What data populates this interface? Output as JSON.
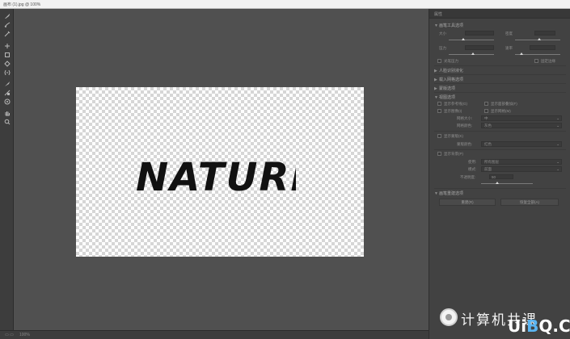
{
  "window": {
    "title": "画布 (1).jpg @ 100%"
  },
  "tools": [
    {
      "name": "brush-icon"
    },
    {
      "name": "reconstruct-icon"
    },
    {
      "name": "smooth-icon"
    },
    {
      "name": "pucker-icon"
    },
    {
      "name": "bloat-icon"
    },
    {
      "name": "push-icon"
    },
    {
      "name": "twirl-icon"
    },
    {
      "name": "mirror-icon"
    },
    {
      "name": "freeze-mask-icon"
    },
    {
      "name": "thaw-mask-icon"
    },
    {
      "name": "face-icon"
    },
    {
      "name": "hand-icon"
    },
    {
      "name": "zoom-icon"
    }
  ],
  "canvas": {
    "text": "NATURE"
  },
  "status": {
    "zoom": "100%"
  },
  "panel": {
    "title": "属性",
    "brush_section": "画笔工具选项",
    "size_label": "大小",
    "size_value": "",
    "density_label": "密度",
    "pressure_label": "压力",
    "pressure_value": "",
    "rate_label": "速率",
    "stylus_label": "光笔压力",
    "pin_label": "固定边缘",
    "face_section": "人脸识别液化",
    "load_mesh_section": "载入网格选项",
    "mask_section": "蒙版选项",
    "view_section": "视图选项",
    "show_guides": "显示参考线(G)",
    "show_face": "显示面部叠加(F)",
    "show_image": "显示图像(I)",
    "show_mesh": "显示网格(M)",
    "mesh_size_label": "网格大小:",
    "mesh_size_value": "中",
    "mesh_color_label": "网格颜色:",
    "mesh_color_value": "灰色",
    "show_mask": "显示蒙版(K)",
    "mask_color_label": "蒙版颜色:",
    "mask_color_value": "红色",
    "show_backdrop": "显示背景(P)",
    "use_label": "使用:",
    "use_value": "所有图层",
    "mode_label": "模式:",
    "mode_value": "前面",
    "opacity_label": "不透明度:",
    "opacity_value": "50",
    "restore_section": "画笔重建选项",
    "rebuild_button": "重建(R)",
    "restore_all_button": "恢复全部(A)"
  },
  "watermark": {
    "text": "计算机共课",
    "brand_a": "Ui",
    "brand_b": "B",
    "brand_c": "Q",
    "brand_d": ".CoM"
  }
}
